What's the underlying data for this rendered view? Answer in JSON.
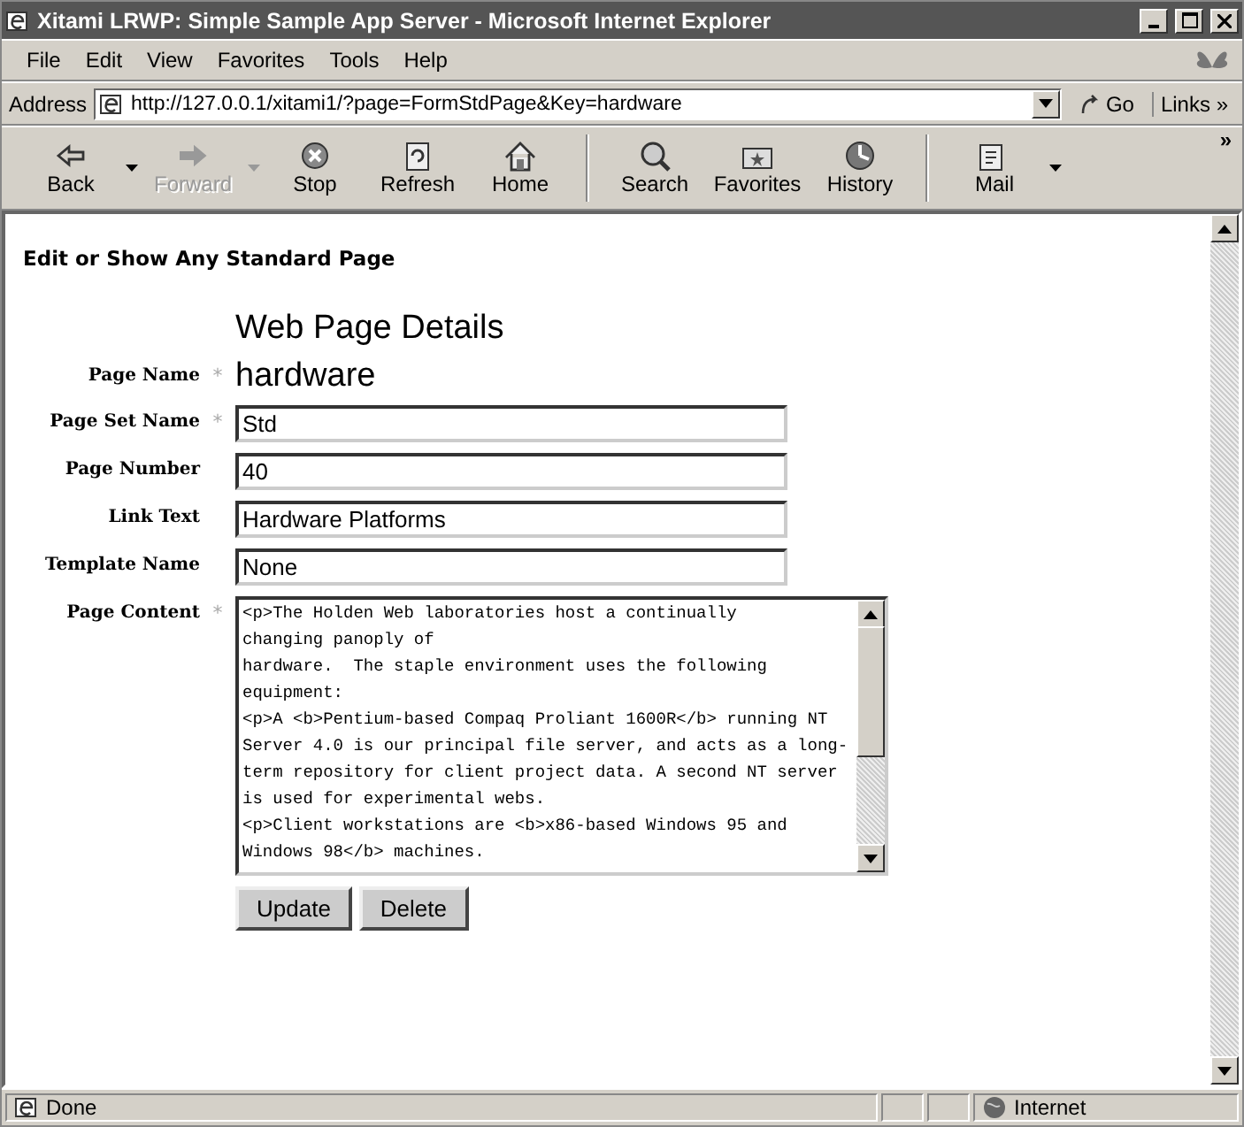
{
  "window": {
    "title": "Xitami LRWP: Simple Sample App Server - Microsoft Internet Explorer"
  },
  "menu": [
    {
      "label": "File"
    },
    {
      "label": "Edit"
    },
    {
      "label": "View"
    },
    {
      "label": "Favorites"
    },
    {
      "label": "Tools"
    },
    {
      "label": "Help"
    }
  ],
  "address": {
    "label": "Address",
    "value": "http://127.0.0.1/xitami1/?page=FormStdPage&Key=hardware",
    "go": "Go",
    "links": "Links",
    "more": "»"
  },
  "toolbar": [
    {
      "label": "Back",
      "kind": "back",
      "disabled": false,
      "dropdown": true
    },
    {
      "label": "Forward",
      "kind": "forward",
      "disabled": true,
      "dropdown": true
    },
    {
      "label": "Stop",
      "kind": "stop",
      "disabled": false
    },
    {
      "label": "Refresh",
      "kind": "refresh",
      "disabled": false
    },
    {
      "label": "Home",
      "kind": "home",
      "disabled": false
    },
    {
      "label": "Search",
      "kind": "search",
      "disabled": false,
      "separator": true
    },
    {
      "label": "Favorites",
      "kind": "favorites",
      "disabled": false
    },
    {
      "label": "History",
      "kind": "history",
      "disabled": false
    },
    {
      "label": "Mail",
      "kind": "mail",
      "disabled": false,
      "dropdown": true,
      "separator": true
    }
  ],
  "toolbar_more": "»",
  "page": {
    "heading": "Edit or Show Any Standard Page",
    "form_title": "Web Page Details",
    "fields": [
      {
        "label": "Page Name",
        "marker": "*",
        "kind": "text",
        "value": "hardware"
      },
      {
        "label": "Page Set Name",
        "marker": "*",
        "kind": "input",
        "value": "Std"
      },
      {
        "label": "Page Number",
        "kind": "input",
        "value": "40"
      },
      {
        "label": "Link Text",
        "kind": "input",
        "value": "Hardware Platforms"
      },
      {
        "label": "Template Name",
        "kind": "input",
        "value": "None"
      },
      {
        "label": "Page Content",
        "marker": "*",
        "kind": "textarea",
        "value": "<p>The Holden Web laboratories host a continually\nchanging panoply of\nhardware.  The staple environment uses the following\nequipment:\n<p>A <b>Pentium-based Compaq Proliant 1600R</b> running NT\nServer 4.0 is our principal file server, and acts as a long-\nterm repository for client project data. A second NT server\nis used for experimental webs.\n<p>Client workstations are <b>x86-based Windows 95 and\nWindows 98</b> machines."
      }
    ],
    "buttons": [
      "Update",
      "Delete"
    ]
  },
  "status_bar": {
    "text": "Done",
    "zone": "Internet"
  }
}
